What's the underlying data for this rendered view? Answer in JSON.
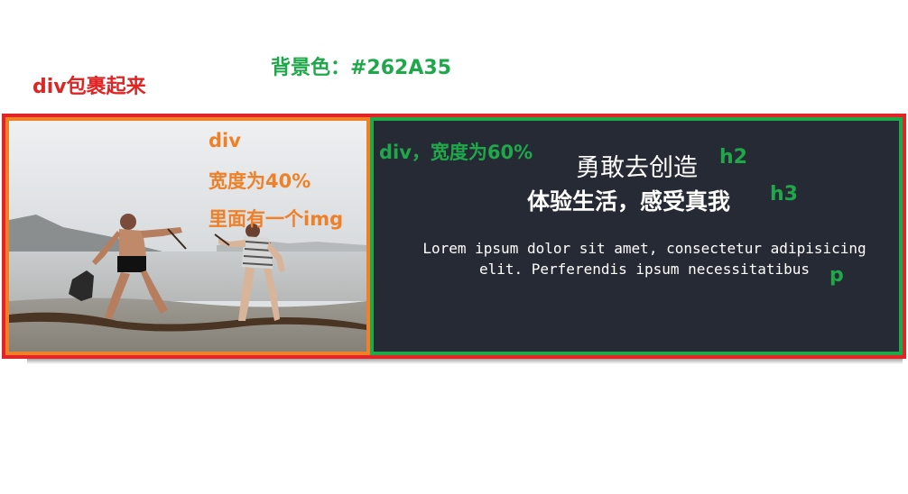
{
  "annotations": {
    "wrapper_note": "div包裹起来",
    "bg_note": "背景色：#262A35",
    "left_div_label": "div",
    "left_width_label": "宽度为40%",
    "left_img_label": "里面有一个img",
    "right_div_label": "div，宽度为60%",
    "h2_tag": "h2",
    "h3_tag": "h3",
    "p_tag": "p"
  },
  "content": {
    "h2": "勇敢去创造",
    "h3": "体验生活，感受真我",
    "paragraph": "Lorem ipsum dolor sit amet, consectetur adipisicing elit. Perferendis ipsum necessitatibus"
  },
  "colors": {
    "background": "#262A35",
    "wrapper_border": "#e42327",
    "left_border": "#f08028",
    "right_border": "#1fa84a"
  }
}
